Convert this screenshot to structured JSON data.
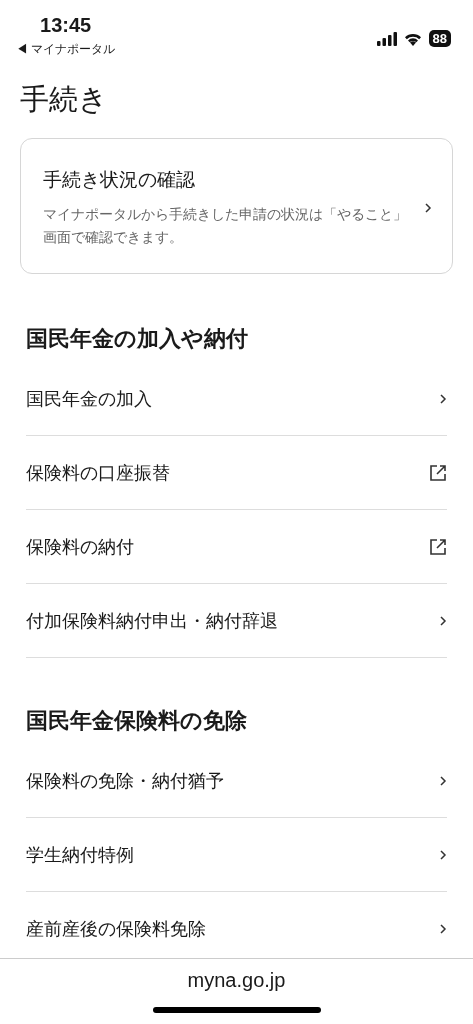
{
  "status_bar": {
    "time": "13:45",
    "back_label": "◀ マイナポータル",
    "battery": "88"
  },
  "page_title": "手続き",
  "status_card": {
    "title": "手続き状況の確認",
    "description": "マイナポータルから手続きした申請の状況は「やること」画面で確認できます。"
  },
  "sections": [
    {
      "heading": "国民年金の加入や納付",
      "items": [
        {
          "label": "国民年金の加入",
          "kind": "link"
        },
        {
          "label": "保険料の口座振替",
          "kind": "external"
        },
        {
          "label": "保険料の納付",
          "kind": "external"
        },
        {
          "label": "付加保険料納付申出・納付辞退",
          "kind": "link"
        }
      ]
    },
    {
      "heading": "国民年金保険料の免除",
      "items": [
        {
          "label": "保険料の免除・納付猶予",
          "kind": "link"
        },
        {
          "label": "学生納付特例",
          "kind": "link"
        },
        {
          "label": "産前産後の保険料免除",
          "kind": "link"
        }
      ]
    }
  ],
  "address_bar": {
    "url": "myna.go.jp"
  }
}
